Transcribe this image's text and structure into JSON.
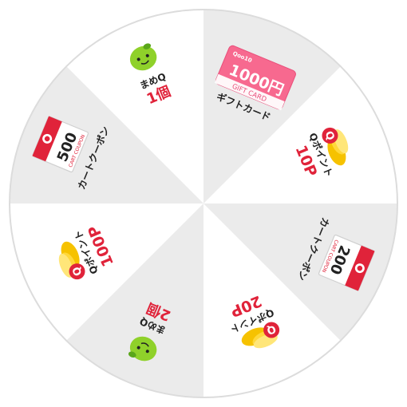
{
  "wheel": {
    "segment_colors": [
      "#ebebeb",
      "#ffffff"
    ],
    "border_color": "#dddddd",
    "accent": "#e0233a",
    "gold": "#f6c200",
    "bean_green": "#8fd12a",
    "prizes": [
      {
        "id": "gift",
        "label": "ギフトカード",
        "card_value": "1000円",
        "card_brand": "Qoo10",
        "card_caption": "GIFT CARD",
        "icon": "gift-card-icon"
      },
      {
        "id": "p10",
        "label": "Qポイント",
        "amount": "10P",
        "icon": "coin-stack-icon"
      },
      {
        "id": "c200",
        "label": "カートクーポン",
        "coupon_value": "200",
        "coupon_caption": "CART COUPON",
        "icon": "coupon-icon"
      },
      {
        "id": "p20",
        "label": "Qポイント",
        "amount": "20P",
        "icon": "coin-stack-icon"
      },
      {
        "id": "mame2",
        "label": "まめQ",
        "amount": "2個",
        "icon": "bean-icon"
      },
      {
        "id": "p100",
        "label": "Qポイント",
        "amount": "100P",
        "icon": "coin-stack-icon"
      },
      {
        "id": "c500",
        "label": "カートクーポン",
        "coupon_value": "500",
        "coupon_caption": "CART COUPON",
        "icon": "coupon-icon"
      },
      {
        "id": "mame1",
        "label": "まめQ",
        "amount": "1個",
        "icon": "bean-icon"
      }
    ]
  }
}
